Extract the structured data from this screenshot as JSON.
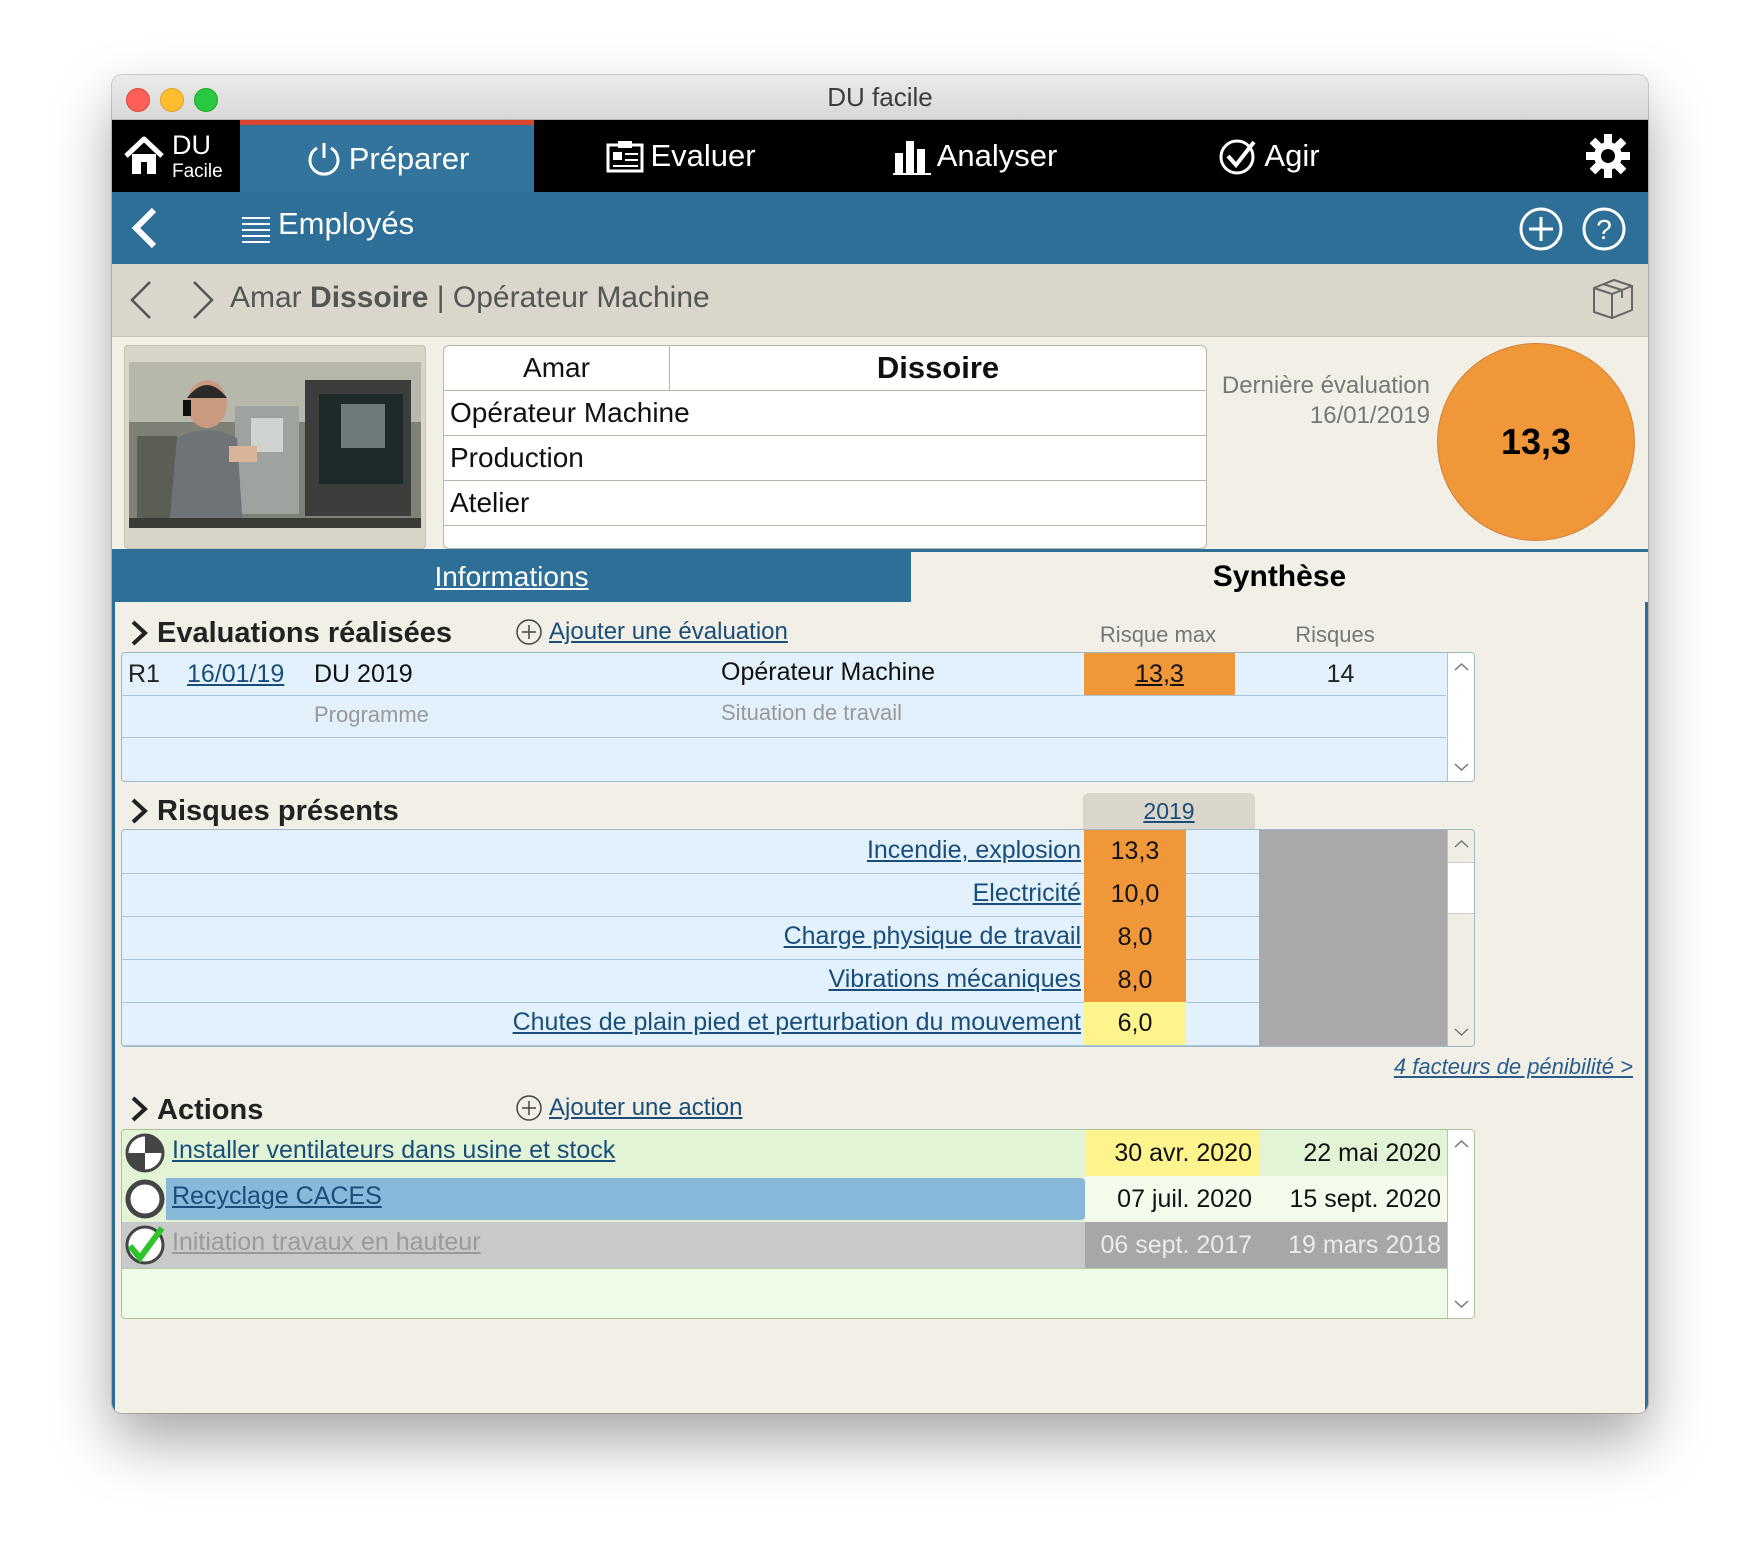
{
  "window": {
    "title": "DU facile"
  },
  "nav": {
    "home_top": "DU",
    "home_bottom": "Facile",
    "tabs": [
      {
        "label": "Préparer"
      },
      {
        "label": "Evaluer"
      },
      {
        "label": "Analyser"
      },
      {
        "label": "Agir"
      }
    ]
  },
  "header": {
    "title": "Employés"
  },
  "breadcrumb": {
    "first_name": "Amar",
    "last_name": "Dissoire",
    "separator": "|",
    "job": "Opérateur Machine"
  },
  "employee": {
    "first_name": "Amar",
    "last_name": "Dissoire",
    "job": "Opérateur Machine",
    "department": "Production",
    "workshop": "Atelier"
  },
  "last_eval": {
    "label": "Dernière évaluation",
    "date": "16/01/2019",
    "score": "13,3"
  },
  "tabs": {
    "info": "Informations",
    "synthese": "Synthèse"
  },
  "evaluations": {
    "title": "Evaluations réalisées",
    "add_label": "Ajouter une évaluation",
    "col_risk_max": "Risque max",
    "col_risks": "Risques",
    "rows": [
      {
        "id": "R1",
        "date": "16/01/19",
        "program": "DU 2019",
        "situation": "Opérateur Machine",
        "risk_max": "13,3",
        "risks": "14"
      }
    ],
    "sub_program": "Programme",
    "sub_situation": "Situation de travail"
  },
  "risks": {
    "title": "Risques présents",
    "year": "2019",
    "rows": [
      {
        "label": "Incendie, explosion",
        "value": "13,3",
        "color": "#f0973a"
      },
      {
        "label": "Electricité",
        "value": "10,0",
        "color": "#f0973a"
      },
      {
        "label": "Charge physique de travail",
        "value": "8,0",
        "color": "#f0973a"
      },
      {
        "label": "Vibrations mécaniques",
        "value": "8,0",
        "color": "#f0973a"
      },
      {
        "label": "Chutes de plain pied et perturbation du mouvement",
        "value": "6,0",
        "color": "#fdf48e"
      }
    ],
    "penibilite_link": "4 facteurs de pénibilité >"
  },
  "actions": {
    "title": "Actions",
    "add_label": "Ajouter une action",
    "rows": [
      {
        "label": "Installer ventilateurs dans usine et stock",
        "start": "30 avr. 2020",
        "end": "22 mai 2020",
        "status": "in-progress"
      },
      {
        "label": "Recyclage CACES",
        "start": "07 juil. 2020",
        "end": "15 sept. 2020",
        "status": "planned"
      },
      {
        "label": "Initiation travaux en hauteur",
        "start": "06 sept. 2017",
        "end": "19 mars 2018",
        "status": "done"
      }
    ]
  },
  "colors": {
    "accent": "#2e6f97",
    "active_tab_bar": "#d9452e",
    "risk_orange": "#f0973a",
    "risk_yellow": "#fdf48e"
  }
}
